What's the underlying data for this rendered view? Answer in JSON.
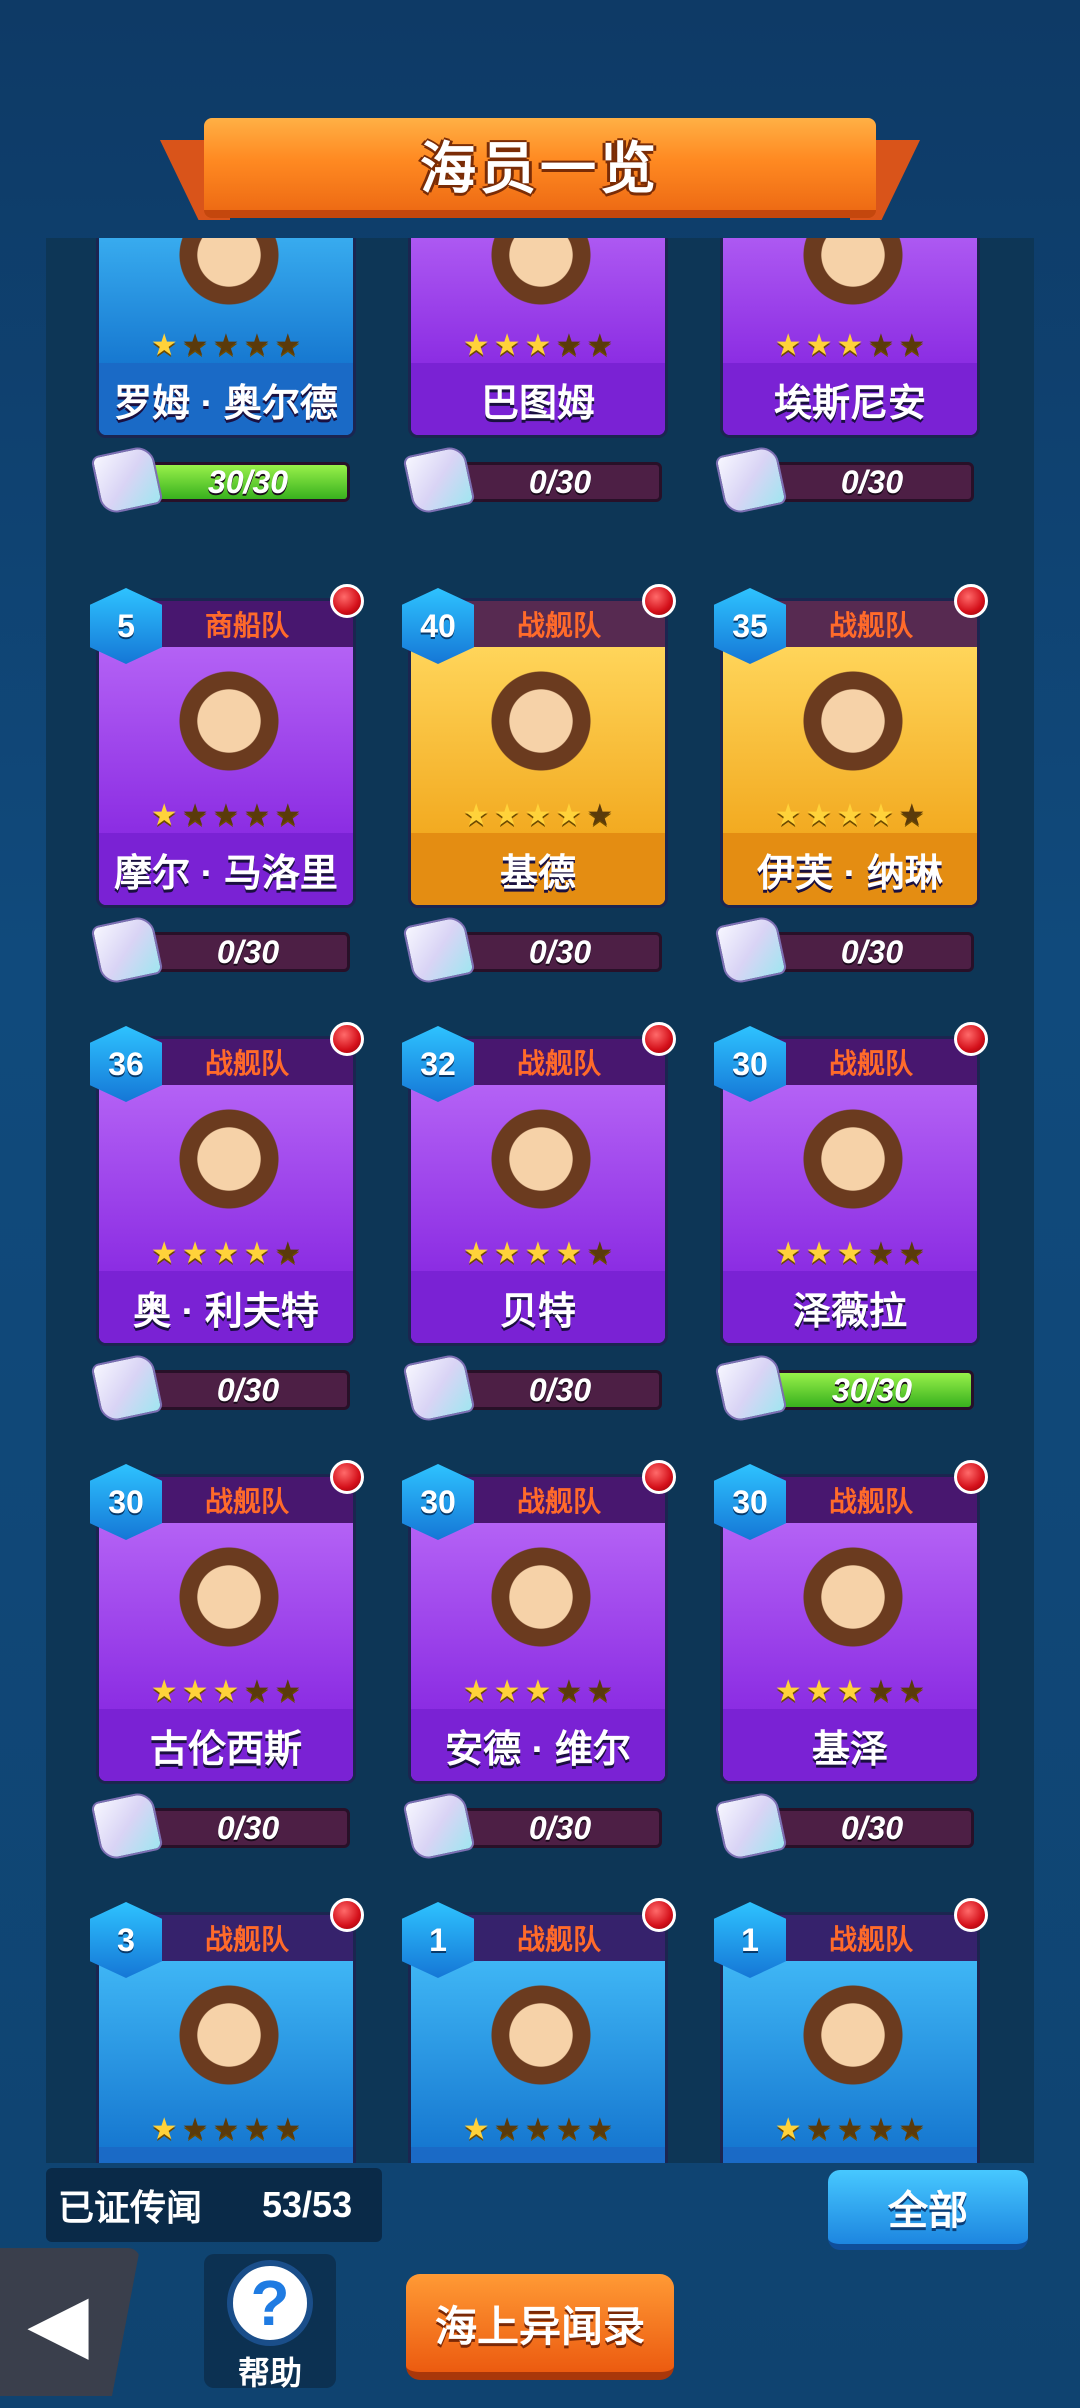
{
  "title": "海员一览",
  "colors": {
    "blue": "#1e8fe0",
    "purple": "#8a2be2",
    "gold": "#f2a91f",
    "faction_text": "#ff6a2a",
    "progress_full": "#5ed12f"
  },
  "crew": [
    {
      "name": "罗姆 · 奥尔德",
      "level": "",
      "faction": "",
      "stars": 1,
      "rarity": "blue",
      "progress": "30/30",
      "progress_fraction": 1.0,
      "new": false
    },
    {
      "name": "巴图姆",
      "level": "",
      "faction": "",
      "stars": 3,
      "rarity": "purple",
      "progress": "0/30",
      "progress_fraction": 0,
      "new": false
    },
    {
      "name": "埃斯尼安",
      "level": "",
      "faction": "",
      "stars": 3,
      "rarity": "purple",
      "progress": "0/30",
      "progress_fraction": 0,
      "new": false
    },
    {
      "name": "摩尔 · 马洛里",
      "level": "5",
      "faction": "商船队",
      "stars": 1,
      "rarity": "purple",
      "progress": "0/30",
      "progress_fraction": 0,
      "new": true
    },
    {
      "name": "基德",
      "level": "40",
      "faction": "战舰队",
      "stars": 4,
      "rarity": "gold",
      "progress": "0/30",
      "progress_fraction": 0,
      "new": true
    },
    {
      "name": "伊芙 · 纳琳",
      "level": "35",
      "faction": "战舰队",
      "stars": 4,
      "rarity": "gold",
      "progress": "0/30",
      "progress_fraction": 0,
      "new": true
    },
    {
      "name": "奥 · 利夫特",
      "level": "36",
      "faction": "战舰队",
      "stars": 4,
      "rarity": "purple",
      "progress": "0/30",
      "progress_fraction": 0,
      "new": true
    },
    {
      "name": "贝特",
      "level": "32",
      "faction": "战舰队",
      "stars": 4,
      "rarity": "purple",
      "progress": "0/30",
      "progress_fraction": 0,
      "new": true
    },
    {
      "name": "泽薇拉",
      "level": "30",
      "faction": "战舰队",
      "stars": 3,
      "rarity": "purple",
      "progress": "30/30",
      "progress_fraction": 1.0,
      "new": true
    },
    {
      "name": "古伦西斯",
      "level": "30",
      "faction": "战舰队",
      "stars": 3,
      "rarity": "purple",
      "progress": "0/30",
      "progress_fraction": 0,
      "new": true
    },
    {
      "name": "安德 · 维尔",
      "level": "30",
      "faction": "战舰队",
      "stars": 3,
      "rarity": "purple",
      "progress": "0/30",
      "progress_fraction": 0,
      "new": true
    },
    {
      "name": "基泽",
      "level": "30",
      "faction": "战舰队",
      "stars": 3,
      "rarity": "purple",
      "progress": "0/30",
      "progress_fraction": 0,
      "new": true
    },
    {
      "name": "",
      "level": "3",
      "faction": "战舰队",
      "stars": 1,
      "rarity": "blue",
      "progress": "",
      "progress_fraction": 0,
      "new": true
    },
    {
      "name": "",
      "level": "1",
      "faction": "战舰队",
      "stars": 1,
      "rarity": "blue",
      "progress": "",
      "progress_fraction": 0,
      "new": true
    },
    {
      "name": "",
      "level": "1",
      "faction": "战舰队",
      "stars": 1,
      "rarity": "blue",
      "progress": "",
      "progress_fraction": 0,
      "new": true
    }
  ],
  "footer": {
    "legend_label": "已证传闻",
    "legend_count": "53/53",
    "all_button": "全部",
    "help_label": "帮助",
    "log_button": "海上异闻录"
  }
}
